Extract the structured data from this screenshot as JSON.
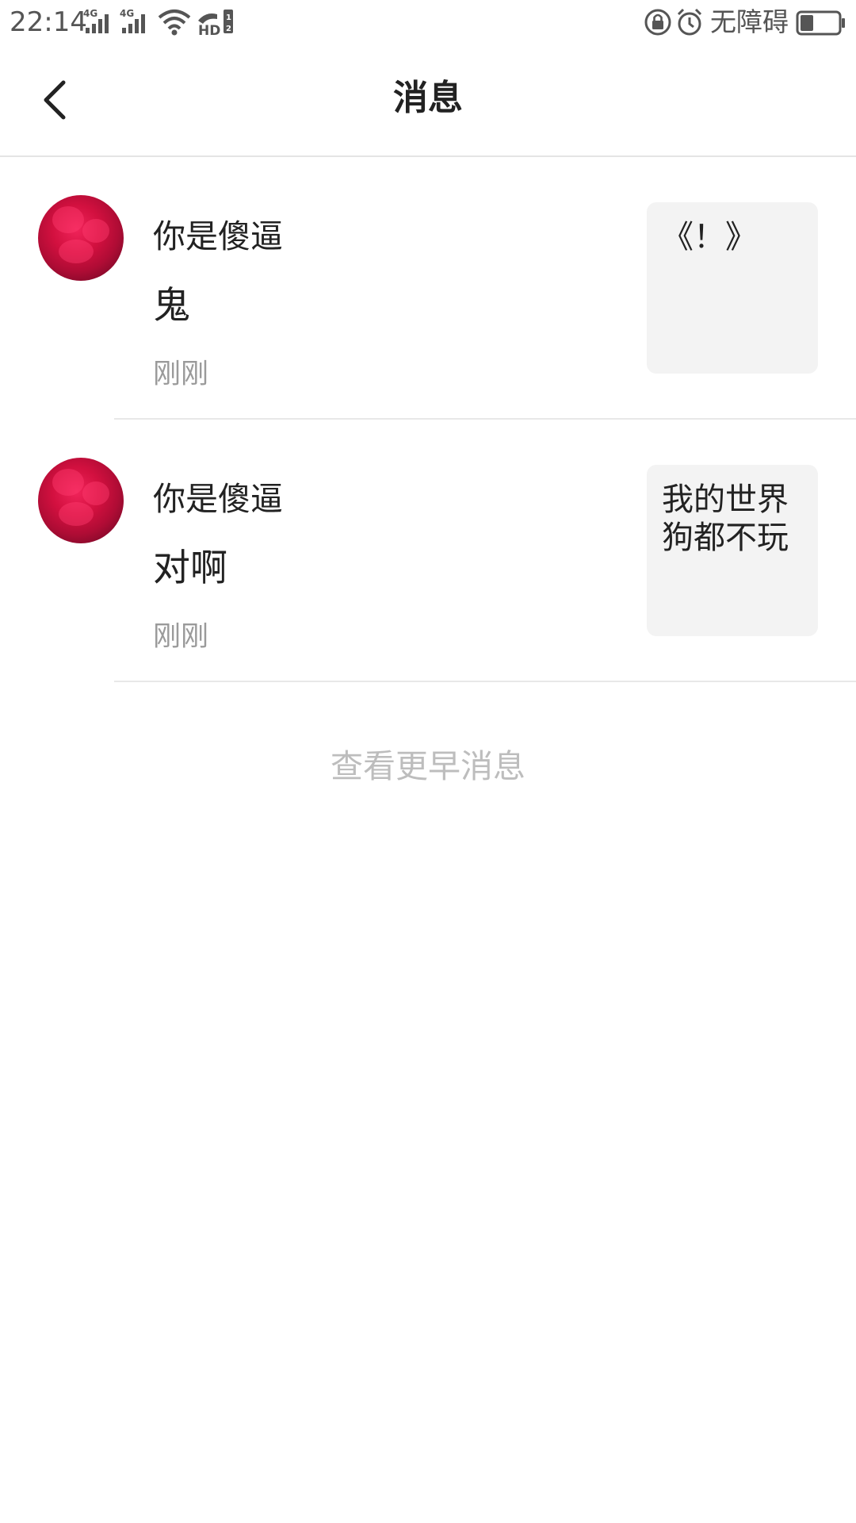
{
  "status_bar": {
    "time": "22:14",
    "network_1": "4G",
    "network_2": "4G",
    "hd_badge": "HD",
    "accessibility_label": "无障碍",
    "icons": [
      "signal-4g-icon",
      "signal-4g-icon",
      "wifi-icon",
      "hd-call-icon",
      "screen-lock-icon",
      "alarm-icon",
      "battery-icon"
    ],
    "battery_level": 0.35
  },
  "header": {
    "back_icon": "chevron-left-icon",
    "title": "消息"
  },
  "messages": [
    {
      "sender": "你是傻逼",
      "text": "鬼",
      "time": "刚刚",
      "quote": "《！》"
    },
    {
      "sender": "你是傻逼",
      "text": "对啊",
      "time": "刚刚",
      "quote": "我的世界狗都不玩"
    }
  ],
  "footer": {
    "load_earlier": "查看更早消息"
  },
  "colors": {
    "background": "#ffffff",
    "primary_text": "#222222",
    "secondary_text": "#9a9a9a",
    "hint_text": "#bdbdbd",
    "divider": "#e8e8e8",
    "quote_background": "#f3f3f3",
    "avatar_red": "#d2103f"
  }
}
